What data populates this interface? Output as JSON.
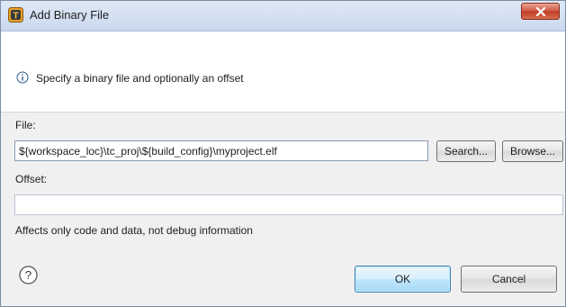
{
  "window": {
    "title": "Add Binary File",
    "app_icon": "eclipse-app-icon",
    "close_icon": "close-icon"
  },
  "header": {
    "icon": "info-icon",
    "message": "Specify a binary file and optionally an offset"
  },
  "form": {
    "file_label": "File:",
    "file_value": "${workspace_loc}\\tc_proj\\${build_config}\\myproject.elf",
    "search_label": "Search...",
    "browse_label": "Browse...",
    "offset_label": "Offset:",
    "offset_value": "",
    "note": "Affects only code and data, not debug information"
  },
  "footer": {
    "help_icon": "help-icon",
    "ok_label": "OK",
    "cancel_label": "Cancel"
  },
  "colors": {
    "titlebar": "#c9d9ee",
    "close_button": "#c0391f",
    "default_button_border": "#3c7fb1",
    "dialog_background": "#f0f0f0"
  }
}
